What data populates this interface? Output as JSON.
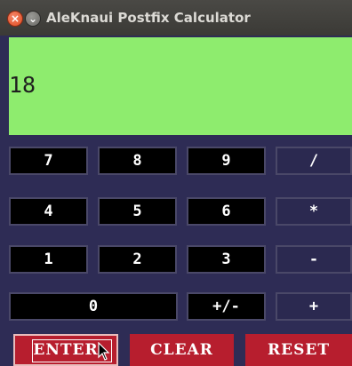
{
  "window": {
    "title": "AleKnaui Postfix Calculator"
  },
  "display": {
    "value": "18"
  },
  "keypad": {
    "rows": [
      [
        "7",
        "8",
        "9",
        "/"
      ],
      [
        "4",
        "5",
        "6",
        "*"
      ],
      [
        "1",
        "2",
        "3",
        "-"
      ],
      [
        "0",
        "+/-",
        "+"
      ]
    ]
  },
  "actions": {
    "enter": "ENTER",
    "clear": "CLEAR",
    "reset": "RESET"
  },
  "colors": {
    "display_bg": "#8eec6e",
    "action_bg": "#b71e2e",
    "window_bg": "#2e2c55"
  }
}
